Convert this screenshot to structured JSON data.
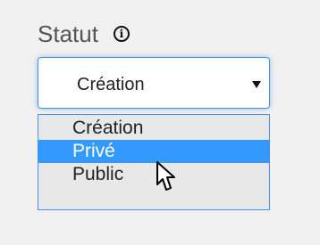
{
  "field": {
    "label": "Statut",
    "info_icon": "info-icon"
  },
  "select": {
    "value": "Création",
    "arrow_icon": "caret-down-icon"
  },
  "options": [
    {
      "label": "Création",
      "selected": false
    },
    {
      "label": "Privé",
      "selected": true
    },
    {
      "label": "Public",
      "selected": false
    }
  ],
  "cursor": "mouse-pointer-icon",
  "colors": {
    "background": "#f1f1f1",
    "selected_option": "#3399ff",
    "focus_border": "#4a90e2",
    "dropdown_background": "#e8e8e8"
  }
}
